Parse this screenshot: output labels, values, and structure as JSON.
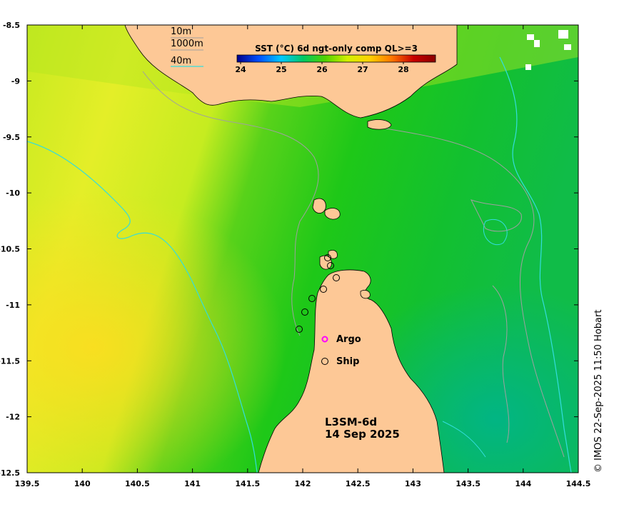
{
  "map": {
    "colorbar": {
      "title": "SST (°C) 6d ngt-only comp QL>=3",
      "ticks": [
        "24",
        "25",
        "26",
        "27",
        "28"
      ],
      "stops": [
        "#00008b",
        "#0050ff",
        "#00c8ff",
        "#00c864",
        "#50d200",
        "#d2f000",
        "#ffd200",
        "#ff7800",
        "#c80000",
        "#8b0000"
      ]
    },
    "depth_legend": {
      "items": [
        {
          "label": "10m",
          "color": "#a0a0a0"
        },
        {
          "label": "1000m",
          "color": "#a0a0a0"
        },
        {
          "label": "40m",
          "color": "#33dddd"
        }
      ]
    },
    "x_axis": {
      "ticks": [
        "139.5",
        "140",
        "140.5",
        "141",
        "141.5",
        "142",
        "142.5",
        "143",
        "143.5",
        "144",
        "144.5"
      ]
    },
    "y_axis": {
      "ticks": [
        "-8.5",
        "-9",
        "-9.5",
        "-10",
        "-10.5",
        "-11",
        "-11.5",
        "-12",
        "-12.5"
      ]
    },
    "markers": {
      "argo_label": "Argo",
      "ship_label": "Ship",
      "argo_color": "#ff00ff"
    },
    "product": {
      "line1": "L3SM-6d",
      "line2": "14 Sep 2025"
    },
    "copyright": "© IMOS 22-Sep-2025 11:50 Hobart",
    "colors": {
      "land": "#fdc896",
      "warm": "#e6f030",
      "mid": "#a0e628",
      "cool": "#14c814",
      "cold": "#00be78"
    }
  }
}
